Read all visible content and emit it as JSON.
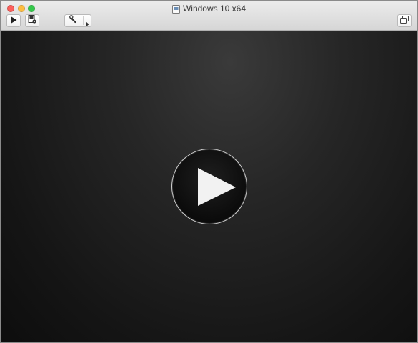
{
  "window": {
    "title": "Windows 10 x64"
  },
  "toolbar": {
    "buttons": [
      {
        "name": "play-button",
        "icon": "play-icon"
      },
      {
        "name": "snapshot-button",
        "icon": "snapshot-icon"
      },
      {
        "name": "settings-button",
        "icon": "wrench-icon"
      },
      {
        "name": "window-mode-button",
        "icon": "window-icon"
      }
    ]
  },
  "vm": {
    "overlay_icon": "play-icon"
  },
  "colors": {
    "close": "#fc605c",
    "minimize": "#fdbc40",
    "maximize": "#34c84a",
    "vm_background": "#1a1a1a",
    "play_triangle": "#f2f2f2"
  }
}
